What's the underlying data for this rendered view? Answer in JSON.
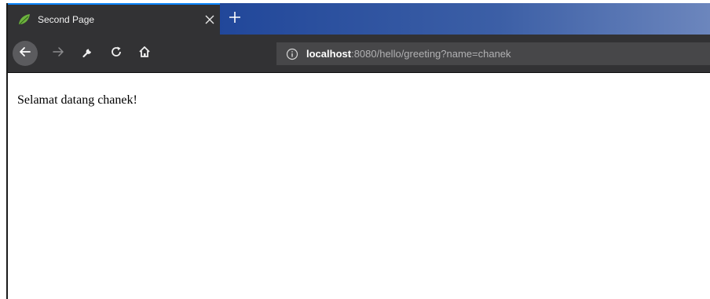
{
  "browser": {
    "tab": {
      "title": "Second Page",
      "favicon": "spring-leaf-icon",
      "close_icon": "close-icon",
      "accent_color": "#0a84ff"
    },
    "new_tab_icon": "plus-icon",
    "toolbar": {
      "back_icon": "arrow-left-icon",
      "forward_icon": "arrow-right-icon",
      "tools_icon": "wrench-icon",
      "reload_icon": "reload-icon",
      "home_icon": "home-icon"
    },
    "urlbar": {
      "info_icon": "info-icon",
      "host": "localhost",
      "rest": ":8080/hello/greeting?name=chanek"
    }
  },
  "page": {
    "greeting": "Selamat datang chanek!"
  }
}
